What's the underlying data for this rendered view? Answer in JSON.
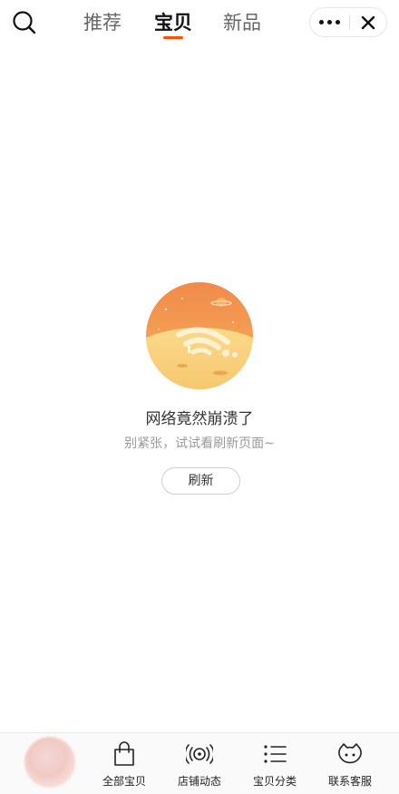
{
  "topbar": {
    "tabs": [
      {
        "label": "推荐",
        "active": false
      },
      {
        "label": "宝贝",
        "active": true
      },
      {
        "label": "新品",
        "active": false
      }
    ],
    "icons": {
      "search": "search-icon",
      "more": "more-dots-icon",
      "close": "close-icon"
    },
    "accent_color": "#ff5000"
  },
  "error": {
    "illustration": "no-network-illustration",
    "title": "网络竟然崩溃了",
    "subtitle": "别紧张，试试看刷新页面~",
    "refresh_label": "刷新"
  },
  "bottom_nav": {
    "items": [
      {
        "label": "全部宝贝",
        "icon": "shopping-bag-icon"
      },
      {
        "label": "店铺动态",
        "icon": "broadcast-icon"
      },
      {
        "label": "宝贝分类",
        "icon": "category-list-icon"
      },
      {
        "label": "联系客服",
        "icon": "customer-service-icon"
      }
    ]
  }
}
